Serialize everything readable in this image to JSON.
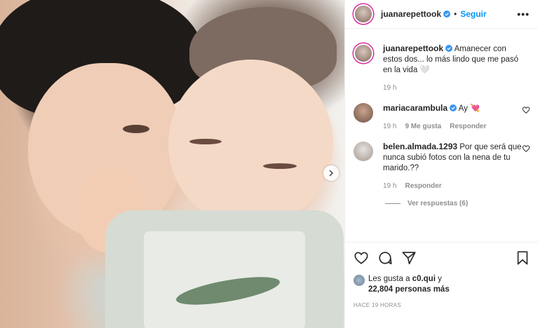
{
  "header": {
    "username": "juanarepettook",
    "separator": "•",
    "follow_label": "Seguir",
    "more_label": "•••"
  },
  "caption": {
    "username": "juanarepettook",
    "text": "Amanecer con estos dos... lo más lindo que me pasó en la vida 🤍",
    "time": "19 h"
  },
  "comments": [
    {
      "username": "mariacarambula",
      "text": "Ay 💘",
      "time": "19 h",
      "likes": "9 Me gusta",
      "reply": "Responder"
    },
    {
      "username": "belen.almada.1293",
      "text": "Por que será que nunca subió fotos con la nena de tu marido.??",
      "time": "19 h",
      "reply": "Responder",
      "view_replies": "Ver respuestas (6)"
    }
  ],
  "likes": {
    "prefix": "Les gusta a",
    "user": "c0.qui",
    "joiner": "y",
    "count": "22,804 personas más"
  },
  "timestamp": "HACE 19 HORAS",
  "colors": {
    "link_blue": "#0095f6",
    "verified_blue": "#3897f0",
    "muted": "#8e8e8e",
    "story_ring": "#d6249f"
  }
}
